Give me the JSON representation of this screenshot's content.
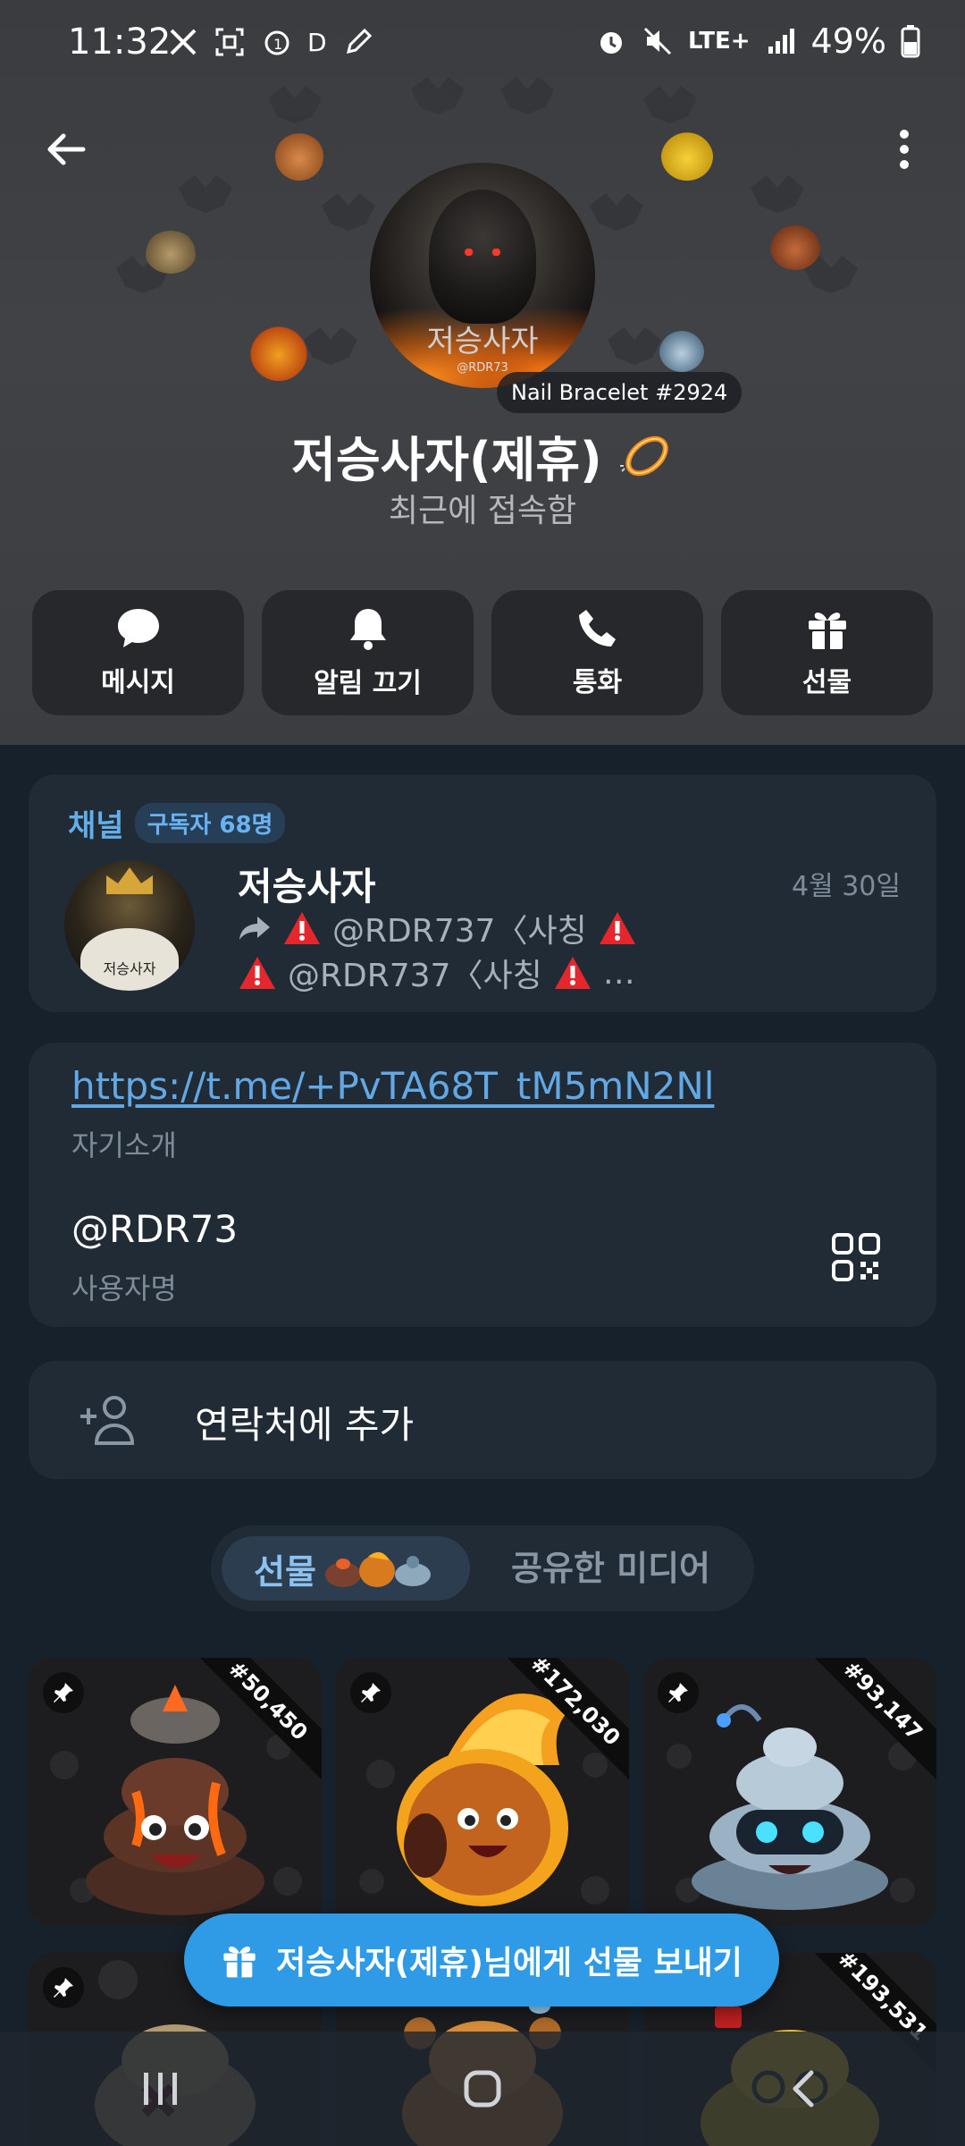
{
  "status_bar": {
    "time": "11:32",
    "lte": "LTE+",
    "battery": "49%",
    "d_label": "D"
  },
  "profile": {
    "avatar_text": "저승사자",
    "avatar_handle": "@RDR73",
    "nft_badge": "Nail Bracelet #2924",
    "name": "저승사자(제휴)",
    "status": "최근에 접속함"
  },
  "actions": [
    {
      "label": "메시지",
      "icon": "chat-bubble-icon"
    },
    {
      "label": "알림 끄기",
      "icon": "bell-icon"
    },
    {
      "label": "통화",
      "icon": "phone-icon"
    },
    {
      "label": "선물",
      "icon": "gift-icon"
    }
  ],
  "channel": {
    "title": "채널",
    "subscribers": "구독자 68명",
    "name": "저승사자",
    "date": "4월 30일",
    "avatar_text": "저승사자",
    "line1": "@RDR737〈사칭",
    "line2": "@RDR737〈사칭",
    "ellipsis": "…"
  },
  "info": {
    "bio_link": "https://t.me/+PvTA68T_tM5mN2Nl",
    "bio_label": "자기소개",
    "username": "@RDR73",
    "username_label": "사용자명"
  },
  "contact": {
    "label": "연락처에 추가"
  },
  "tabs": {
    "gifts": "선물",
    "media": "공유한 미디어"
  },
  "gifts": [
    {
      "number": "#50,450",
      "theme": "volcano",
      "color": "#e2531c"
    },
    {
      "number": "#172,030",
      "theme": "fire",
      "color": "#f0a020"
    },
    {
      "number": "#93,147",
      "theme": "robot",
      "color": "#9fb6c8"
    },
    {
      "number": "",
      "theme": "bones",
      "color": "#cbbf9a"
    },
    {
      "number": "",
      "theme": "bee",
      "color": "#e0a040"
    },
    {
      "number": "#193,531",
      "theme": "nerd",
      "color": "#e8d040"
    }
  ],
  "send_gift": {
    "label": "저승사자(제휴)님에게 선물 보내기"
  }
}
